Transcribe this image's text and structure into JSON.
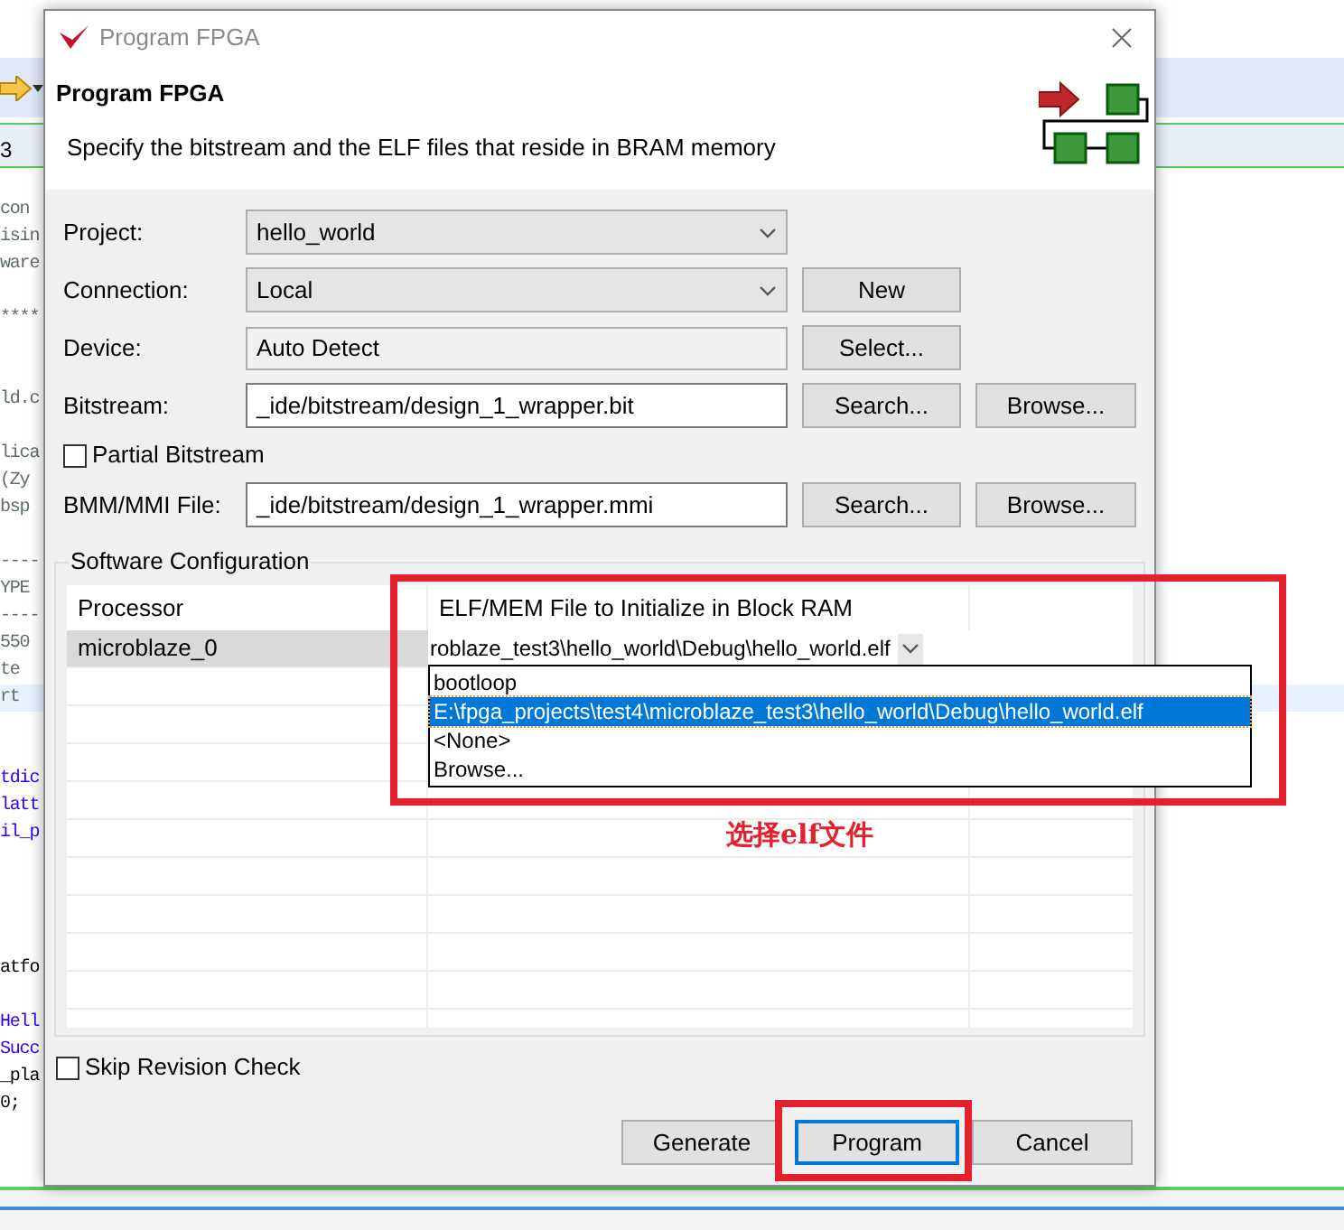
{
  "background_editor": {
    "tab_label": "3",
    "lines": [
      {
        "text": "con",
        "kind": "comment",
        "selected": false
      },
      {
        "text": "isin",
        "kind": "comment",
        "selected": false
      },
      {
        "text": "ware",
        "kind": "comment",
        "selected": false
      },
      {
        "text": "****",
        "kind": "comment",
        "selected": false
      },
      {
        "text": "ld.c",
        "kind": "comment",
        "selected": false
      },
      {
        "text": "lica",
        "kind": "comment",
        "selected": false
      },
      {
        "text": "(Zy",
        "kind": "comment",
        "selected": false
      },
      {
        "text": "bsp",
        "kind": "comment",
        "selected": false
      },
      {
        "text": "----",
        "kind": "comment",
        "selected": false
      },
      {
        "text": "YPE",
        "kind": "comment",
        "selected": false
      },
      {
        "text": "----",
        "kind": "comment",
        "selected": false
      },
      {
        "text": "550",
        "kind": "comment",
        "selected": false
      },
      {
        "text": "te",
        "kind": "comment",
        "selected": false
      },
      {
        "text": "rt",
        "kind": "comment",
        "selected": true
      },
      {
        "text": "tdic",
        "kind": "keyword",
        "selected": false
      },
      {
        "text": "latt",
        "kind": "keyword",
        "selected": false
      },
      {
        "text": "il_p",
        "kind": "keyword",
        "selected": false
      },
      {
        "text": "atfo",
        "kind": "code",
        "selected": false
      },
      {
        "text": "Hell",
        "kind": "keyword",
        "selected": false
      },
      {
        "text": "Succ",
        "kind": "keyword",
        "selected": false
      },
      {
        "text": "_pla",
        "kind": "code",
        "selected": false
      },
      {
        "text": "0;",
        "kind": "code",
        "selected": false
      }
    ]
  },
  "dialog": {
    "title": "Program FPGA",
    "heading": "Program FPGA",
    "description": "Specify the bitstream and the ELF files that reside in BRAM memory",
    "fields": [
      {
        "kind": "combo",
        "label": "Project:",
        "value": "hello_world"
      },
      {
        "kind": "combo",
        "label": "Connection:",
        "value": "Local",
        "buttons": [
          "New"
        ]
      },
      {
        "kind": "readonly",
        "label": "Device:",
        "value": "Auto Detect",
        "buttons": [
          "Select..."
        ]
      },
      {
        "kind": "text",
        "label": "Bitstream:",
        "value": "_ide/bitstream/design_1_wrapper.bit",
        "buttons": [
          "Search...",
          "Browse..."
        ]
      },
      {
        "kind": "checkbox",
        "label": "Partial Bitstream",
        "checked": false
      },
      {
        "kind": "text",
        "label": "BMM/MMI File:",
        "value": "_ide/bitstream/design_1_wrapper.mmi",
        "buttons": [
          "Search...",
          "Browse..."
        ]
      }
    ],
    "software_configuration": {
      "title": "Software Configuration",
      "columns": [
        "Processor",
        "ELF/MEM File to Initialize in Block RAM"
      ],
      "rows": [
        {
          "processor": "microblaze_0",
          "elf_file": "roblaze_test3\\hello_world\\Debug\\hello_world.elf",
          "selected": true
        }
      ],
      "dropdown_options": [
        {
          "label": "bootloop",
          "selected": false
        },
        {
          "label": "E:\\fpga_projects\\test4\\microblaze_test3\\hello_world\\Debug\\hello_world.elf",
          "selected": true
        },
        {
          "label": "<None>",
          "selected": false
        },
        {
          "label": "Browse...",
          "selected": false
        }
      ]
    },
    "skip_revision_check": {
      "label": "Skip Revision Check",
      "checked": false
    },
    "buttons": [
      {
        "label": "Generate",
        "focused": false
      },
      {
        "label": "Program",
        "focused": true
      },
      {
        "label": "Cancel",
        "focused": false
      }
    ]
  },
  "annotation": {
    "label": "选择elf文件"
  }
}
